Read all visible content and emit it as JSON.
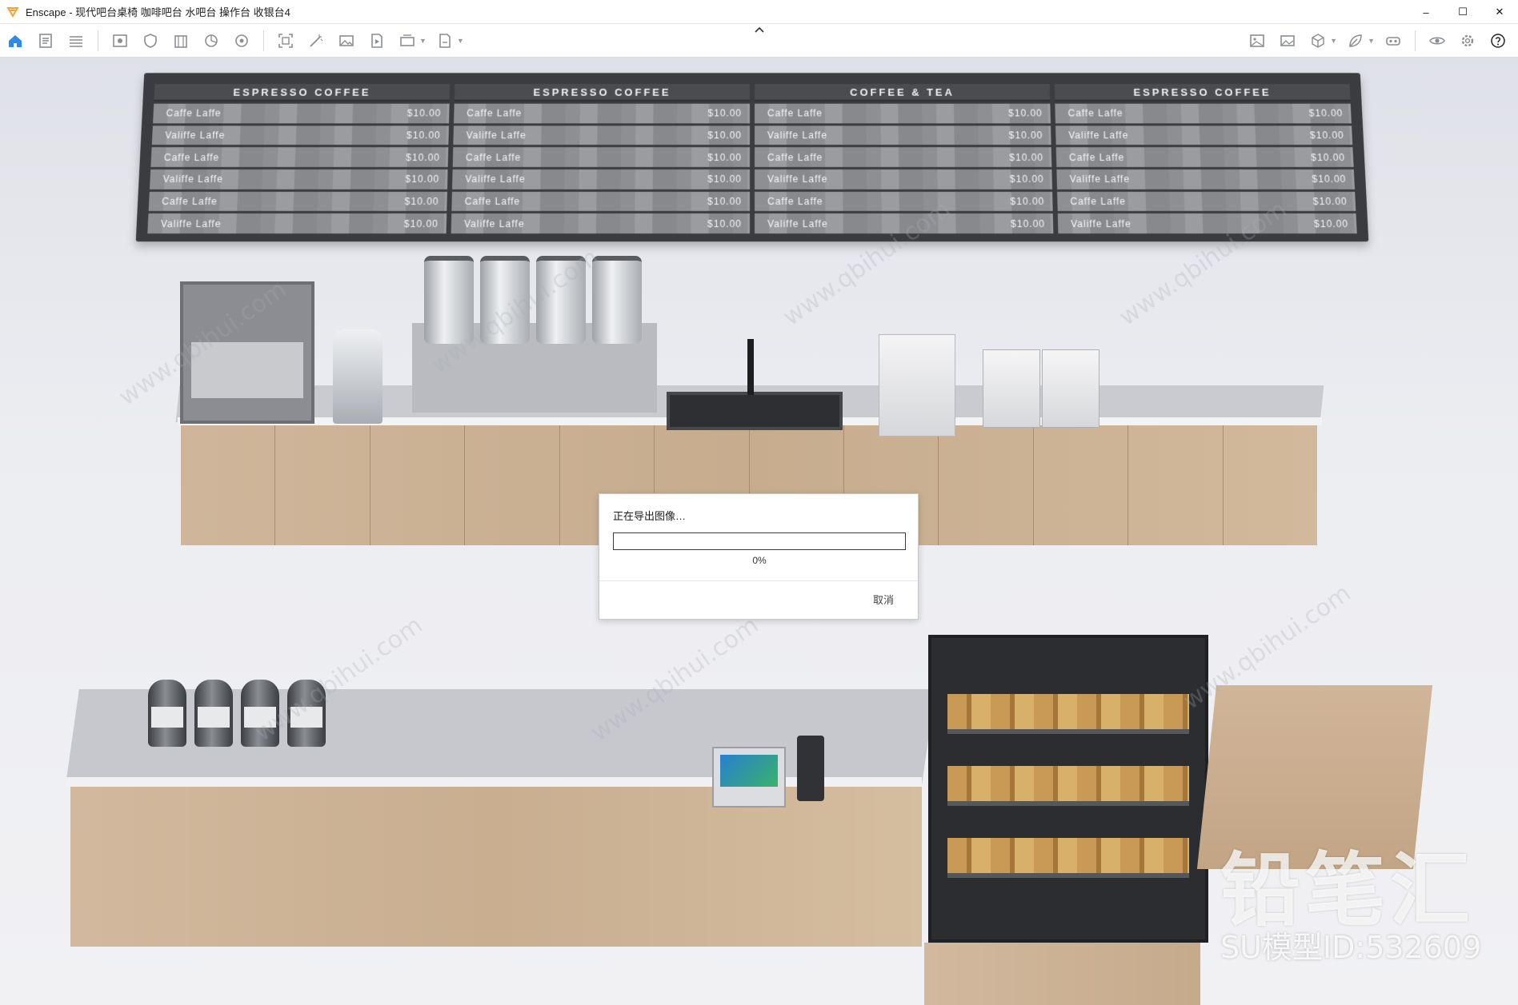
{
  "window": {
    "title": "Enscape - 现代吧台桌椅 咖啡吧台 水吧台 操作台 收银台4",
    "controls": {
      "minimize": "–",
      "maximize": "☐",
      "close": "✕"
    },
    "accent_color": "#f2a33a"
  },
  "toolbar": {
    "left_icons": [
      "home-icon",
      "document-icon",
      "list-icon",
      "view-icon",
      "shield-icon",
      "building-icon",
      "chart-icon",
      "settings-wheel-icon",
      "capture-icon",
      "magic-wand-icon",
      "image-icon",
      "video-icon",
      "batch-render-icon",
      "export-icon"
    ],
    "right_icons": [
      "asset-image-icon",
      "gallery-icon",
      "cube-icon",
      "leaf-icon",
      "vr-headset-icon",
      "eye-icon",
      "gear-icon",
      "help-icon"
    ],
    "accent_color": "#2d8ae6",
    "collapse_icon": "chevron-up-icon"
  },
  "menu_board": {
    "panels": [
      {
        "title": "ESPRESSO COFFEE",
        "items": [
          {
            "name": "Caffe Laffe",
            "price": "$10.00"
          },
          {
            "name": "Valiffe Laffe",
            "price": "$10.00"
          },
          {
            "name": "Caffe Laffe",
            "price": "$10.00"
          },
          {
            "name": "Valiffe Laffe",
            "price": "$10.00"
          },
          {
            "name": "Caffe Laffe",
            "price": "$10.00"
          },
          {
            "name": "Valiffe Laffe",
            "price": "$10.00"
          }
        ]
      },
      {
        "title": "ESPRESSO COFFEE",
        "items": [
          {
            "name": "Caffe Laffe",
            "price": "$10.00"
          },
          {
            "name": "Valiffe Laffe",
            "price": "$10.00"
          },
          {
            "name": "Caffe Laffe",
            "price": "$10.00"
          },
          {
            "name": "Valiffe Laffe",
            "price": "$10.00"
          },
          {
            "name": "Caffe Laffe",
            "price": "$10.00"
          },
          {
            "name": "Valiffe Laffe",
            "price": "$10.00"
          }
        ]
      },
      {
        "title": "COFFEE & TEA",
        "items": [
          {
            "name": "Caffe Laffe",
            "price": "$10.00"
          },
          {
            "name": "Valiffe Laffe",
            "price": "$10.00"
          },
          {
            "name": "Caffe Laffe",
            "price": "$10.00"
          },
          {
            "name": "Valiffe Laffe",
            "price": "$10.00"
          },
          {
            "name": "Caffe Laffe",
            "price": "$10.00"
          },
          {
            "name": "Valiffe Laffe",
            "price": "$10.00"
          }
        ]
      },
      {
        "title": "ESPRESSO COFFEE",
        "items": [
          {
            "name": "Caffe Laffe",
            "price": "$10.00"
          },
          {
            "name": "Valiffe Laffe",
            "price": "$10.00"
          },
          {
            "name": "Caffe Laffe",
            "price": "$10.00"
          },
          {
            "name": "Valiffe Laffe",
            "price": "$10.00"
          },
          {
            "name": "Caffe Laffe",
            "price": "$10.00"
          },
          {
            "name": "Valiffe Laffe",
            "price": "$10.00"
          }
        ]
      }
    ]
  },
  "dialog": {
    "message": "正在导出图像…",
    "progress": 0,
    "progress_label": "0%",
    "cancel_label": "取消"
  },
  "watermark": {
    "brand": "铅笔汇",
    "model_id": "SU模型ID:532609",
    "tile_text": "www.qbihui.com"
  }
}
